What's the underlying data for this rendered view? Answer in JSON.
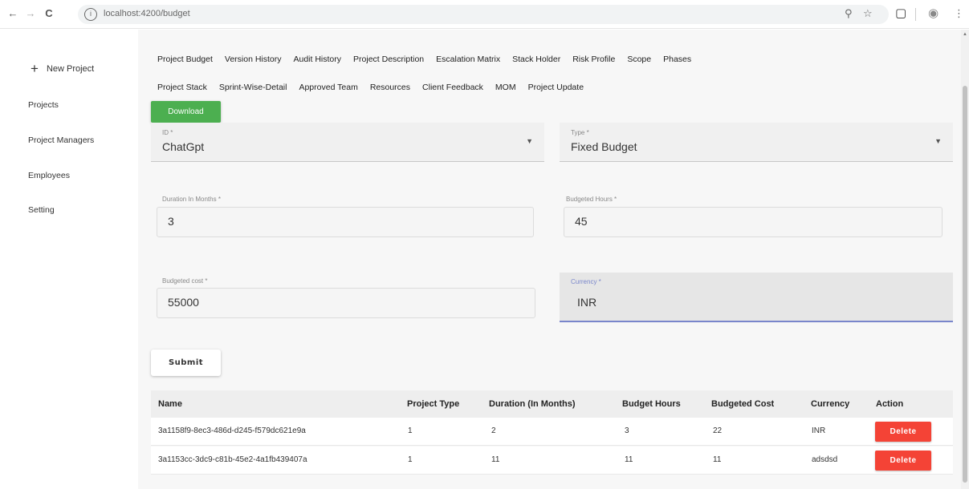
{
  "browser": {
    "url": "localhost:4200/budget",
    "back_icon": "←",
    "forward_icon": "→",
    "reload_icon": "C"
  },
  "sidebar": {
    "new_project": "New Project",
    "items": [
      "Projects",
      "Project Managers",
      "Employees",
      "Setting"
    ]
  },
  "tabs": {
    "row1": [
      "Project Budget",
      "Version History",
      "Audit History",
      "Project Description",
      "Escalation Matrix",
      "Stack Holder",
      "Risk Profile",
      "Scope",
      "Phases"
    ],
    "row2": [
      "Project Stack",
      "Sprint-Wise-Detail",
      "Approved Team",
      "Resources",
      "Client Feedback",
      "MOM",
      "Project Update"
    ]
  },
  "download_label": "Download",
  "form": {
    "id": {
      "label": "ID *",
      "value": "ChatGpt"
    },
    "type": {
      "label": "Type *",
      "value": "Fixed Budget"
    },
    "duration": {
      "label": "Duration In Months *",
      "value": "3"
    },
    "hours": {
      "label": "Budgeted Hours *",
      "value": "45"
    },
    "cost": {
      "label": "Budgeted cost *",
      "value": "55000"
    },
    "currency": {
      "label": "Currency *",
      "value": "INR"
    }
  },
  "submit_label": "Submit",
  "table": {
    "headers": [
      "Name",
      "Project Type",
      "Duration (In Months)",
      "Budget Hours",
      "Budgeted Cost",
      "Currency",
      "Action"
    ],
    "rows": [
      {
        "name": "3a1158f9-8ec3-486d-d245-f579dc621e9a",
        "type": "1",
        "duration": "2",
        "hours": "3",
        "cost": "22",
        "currency": "INR",
        "action": "Delete"
      },
      {
        "name": "3a1153cc-3dc9-c81b-45e2-4a1fb439407a",
        "type": "1",
        "duration": "11",
        "hours": "11",
        "cost": "11",
        "currency": "adsdsd",
        "action": "Delete"
      }
    ]
  },
  "colors": {
    "download": "#4caf50",
    "delete": "#f44336",
    "focus": "#7986cb"
  }
}
